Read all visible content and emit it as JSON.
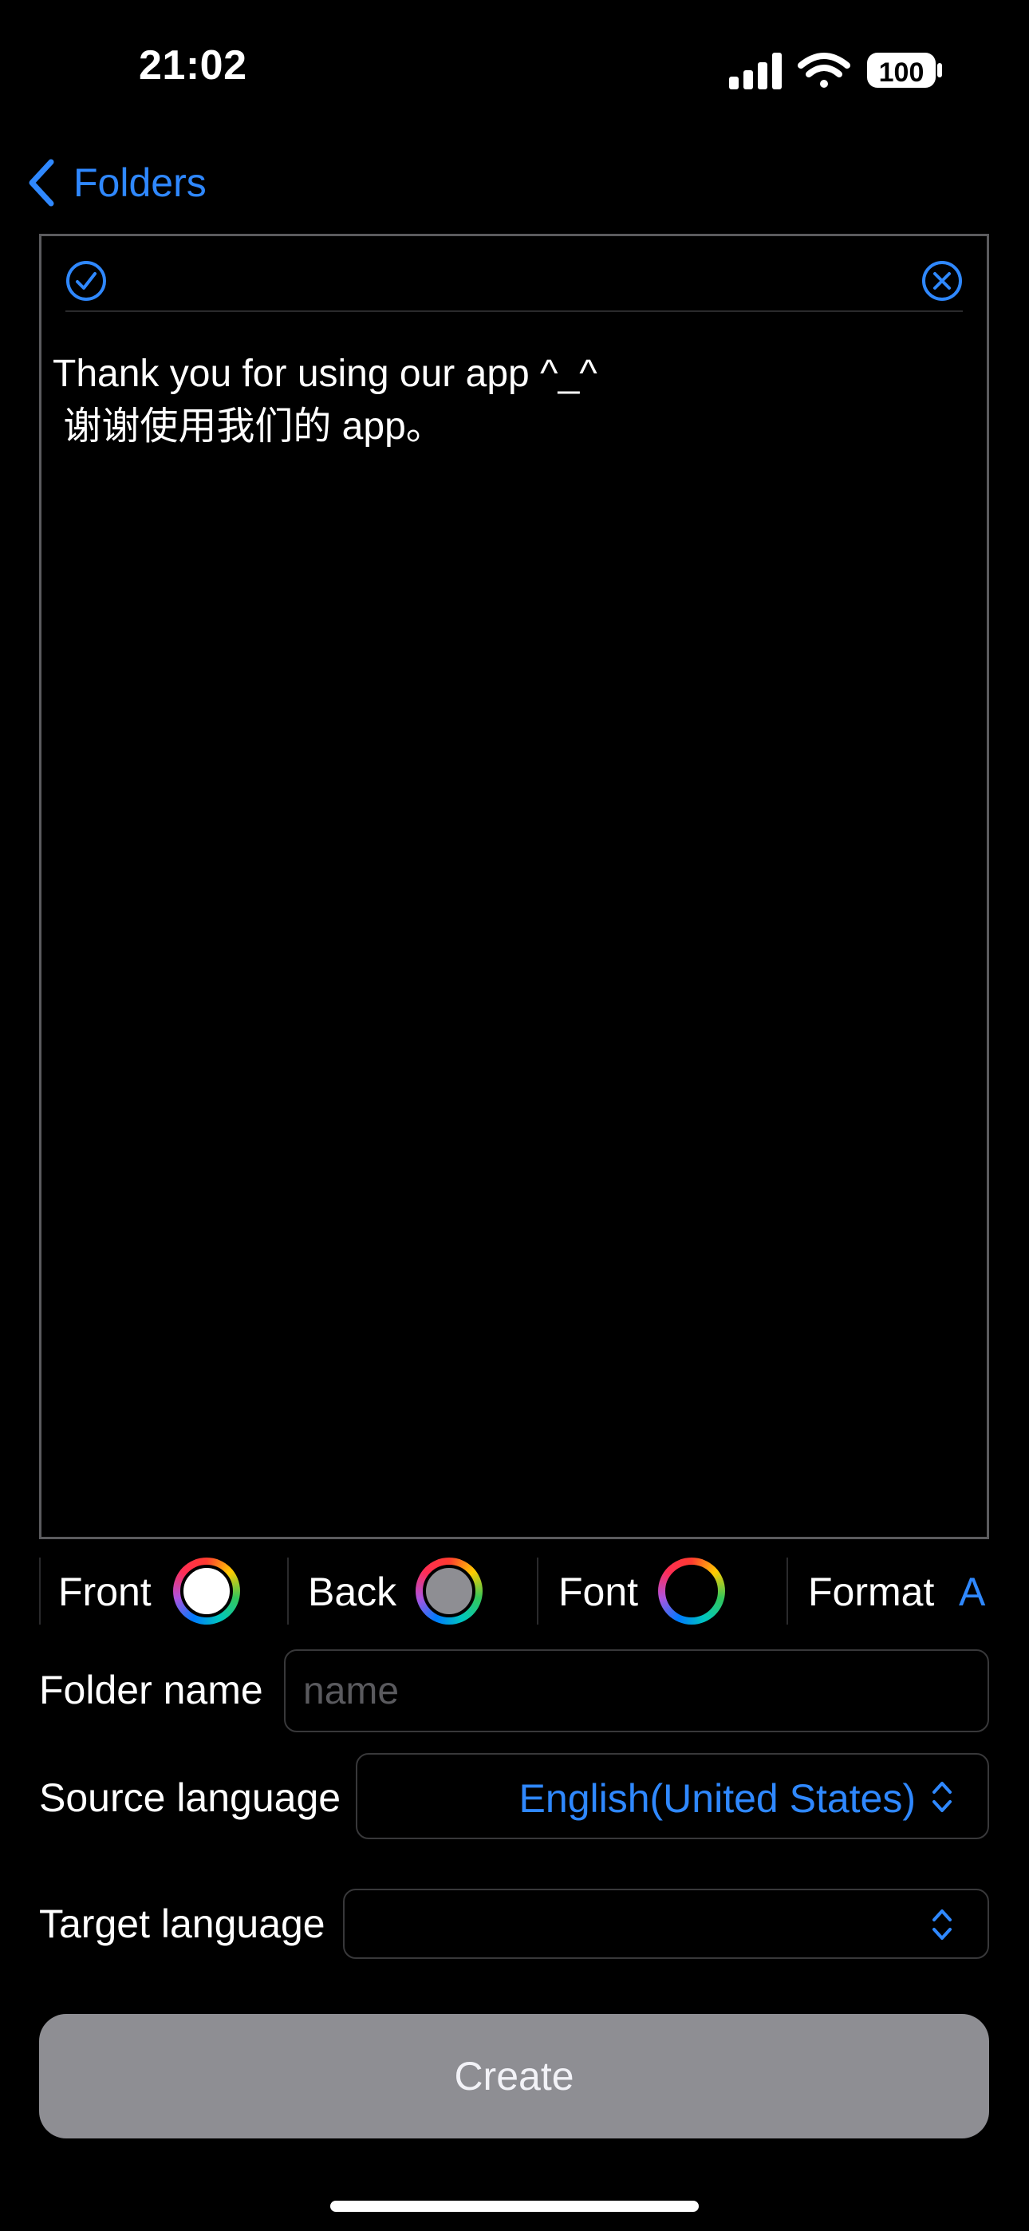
{
  "status_bar": {
    "time": "21:02",
    "battery": "100",
    "icons": [
      "cellular-signal-icon",
      "wifi-icon",
      "battery-icon"
    ]
  },
  "nav": {
    "back_label": "Folders",
    "back_icon": "chevron-left-icon"
  },
  "editor": {
    "confirm_icon": "checkmark-circle-icon",
    "clear_icon": "xmark-circle-icon",
    "text": "Thank you for using our app ^_^\n 谢谢使用我们的 app。"
  },
  "options": {
    "front_label": "Front",
    "front_color": "#ffffff",
    "back_label": "Back",
    "back_color": "#8e8e93",
    "font_label": "Font",
    "font_color": "#000000",
    "format_label": "Format",
    "format_value": "A"
  },
  "form": {
    "folder_name_label": "Folder name",
    "folder_name_placeholder": "name",
    "folder_name_value": "",
    "source_language_label": "Source language",
    "source_language_value": "English(United States)",
    "target_language_label": "Target language",
    "target_language_value": ""
  },
  "create_button": {
    "label": "Create"
  },
  "colors": {
    "accent": "#2f88ff",
    "background": "#000000",
    "button_disabled": "#8e8e93"
  }
}
